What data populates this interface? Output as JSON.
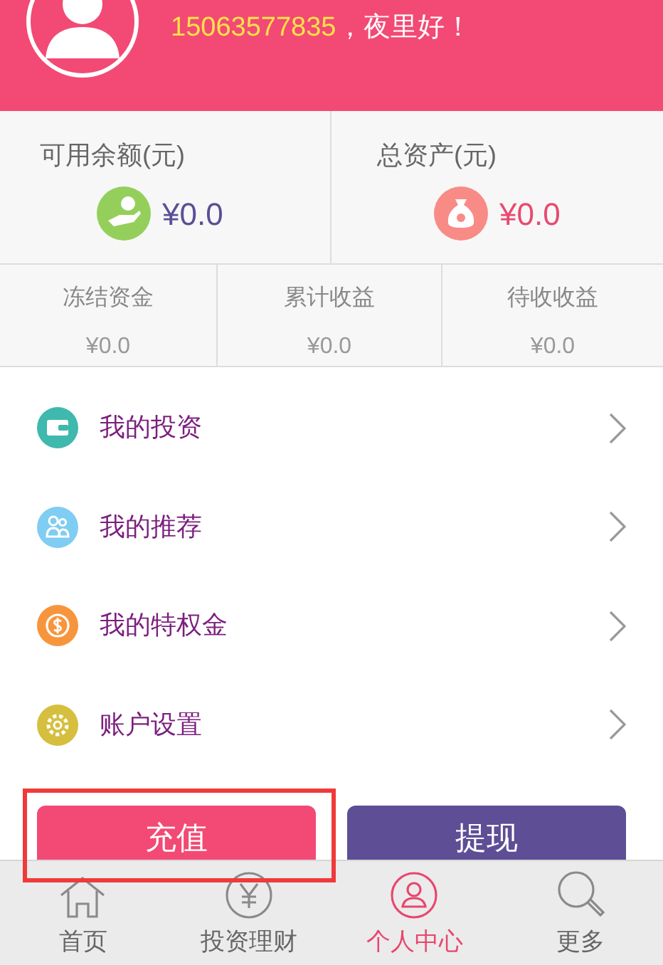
{
  "header": {
    "phone": "15063577835",
    "greeting": "，夜里好！"
  },
  "balances": [
    {
      "label": "可用余额(元)",
      "amount": "¥0.0",
      "kind": "cash"
    },
    {
      "label": "总资产(元)",
      "amount": "¥0.0",
      "kind": "bag"
    }
  ],
  "stats": [
    {
      "label": "冻结资金",
      "amount": "¥0.0"
    },
    {
      "label": "累计收益",
      "amount": "¥0.0"
    },
    {
      "label": "待收收益",
      "amount": "¥0.0"
    }
  ],
  "menu": [
    {
      "label": "我的投资",
      "kind": "wallet"
    },
    {
      "label": "我的推荐",
      "kind": "people"
    },
    {
      "label": "我的特权金",
      "kind": "coin"
    },
    {
      "label": "账户设置",
      "kind": "gear"
    }
  ],
  "actions": [
    {
      "label": "充值",
      "kind": "recharge",
      "highlighted": true
    },
    {
      "label": "提现",
      "kind": "withdraw",
      "highlighted": false
    }
  ],
  "tabs": [
    {
      "label": "首页",
      "kind": "home",
      "selected": false
    },
    {
      "label": "投资理财",
      "kind": "yen",
      "selected": false
    },
    {
      "label": "个人中心",
      "kind": "user",
      "selected": true
    },
    {
      "label": "更多",
      "kind": "search",
      "selected": false
    }
  ]
}
